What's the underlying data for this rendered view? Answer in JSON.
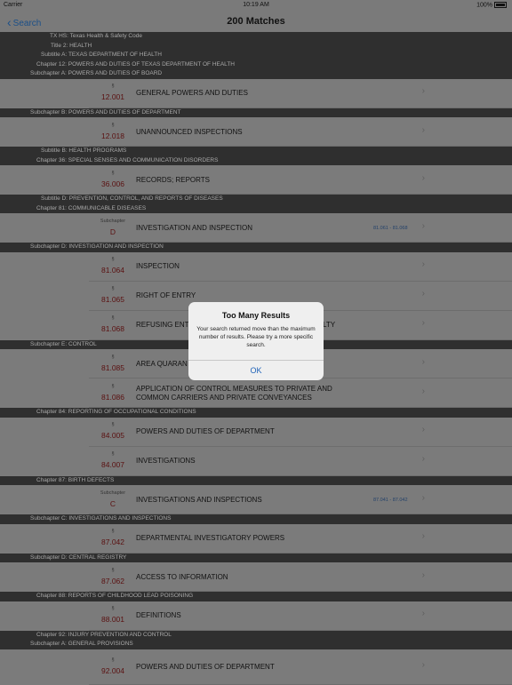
{
  "status_bar": {
    "carrier": "Carrier",
    "time": "10:19 AM",
    "battery": "100%"
  },
  "nav": {
    "back_label": "Search",
    "title": "200 Matches"
  },
  "list": [
    {
      "kind": "header",
      "indent": 56,
      "text": "TX HS: Texas Health & Safety Code"
    },
    {
      "kind": "header",
      "indent": 57,
      "text": "Title 2: HEALTH"
    },
    {
      "kind": "header",
      "indent": 46,
      "text": "Subtitle A: TEXAS DEPARTMENT OF HEALTH"
    },
    {
      "kind": "header",
      "indent": 41,
      "text": "Chapter 12: POWERS AND DUTIES OF TEXAS DEPARTMENT OF HEALTH"
    },
    {
      "kind": "header",
      "indent": 34,
      "text": "Subchapter A: POWERS AND DUTIES OF BOARD"
    },
    {
      "kind": "row",
      "h": 33,
      "symbol": "§",
      "number": "12.001",
      "title": "GENERAL POWERS AND DUTIES"
    },
    {
      "kind": "header",
      "indent": 34,
      "text": "Subchapter B: POWERS AND DUTIES OF DEPARTMENT"
    },
    {
      "kind": "row",
      "h": 33,
      "symbol": "§",
      "number": "12.018",
      "title": "UNANNOUNCED INSPECTIONS"
    },
    {
      "kind": "header",
      "indent": 46,
      "text": "Subtitle B: HEALTH PROGRAMS"
    },
    {
      "kind": "header",
      "indent": 41,
      "text": "Chapter 36: SPECIAL SENSES AND COMMUNICATION DISORDERS"
    },
    {
      "kind": "row",
      "h": 33,
      "symbol": "§",
      "number": "36.006",
      "title": "RECORDS;  REPORTS"
    },
    {
      "kind": "header",
      "indent": 46,
      "text": "Subtitle D: PREVENTION, CONTROL, AND REPORTS OF DISEASES"
    },
    {
      "kind": "header",
      "indent": 41,
      "text": "Chapter 81: COMMUNICABLE DISEASES"
    },
    {
      "kind": "row",
      "h": 33,
      "symbol": "Subchapter",
      "number": "D",
      "title": "INVESTIGATION AND INSPECTION",
      "range": "81.061 - 81.068"
    },
    {
      "kind": "header",
      "indent": 34,
      "text": "Subchapter D: INVESTIGATION AND INSPECTION"
    },
    {
      "kind": "row",
      "h": 33,
      "symbol": "§",
      "number": "81.064",
      "title": "INSPECTION"
    },
    {
      "kind": "row",
      "h": 33,
      "symbol": "§",
      "number": "81.065",
      "title": "RIGHT OF ENTRY"
    },
    {
      "kind": "row",
      "h": 33,
      "symbol": "§",
      "number": "81.068",
      "title": "REFUSING ENT",
      "title_end": "LTY"
    },
    {
      "kind": "header",
      "indent": 34,
      "text": "Subchapter E: CONTROL"
    },
    {
      "kind": "row",
      "h": 33,
      "symbol": "§",
      "number": "81.085",
      "title": "AREA QUARAN"
    },
    {
      "kind": "row",
      "h": 33,
      "symbol": "§",
      "number": "81.086",
      "title": "APPLICATION OF CONTROL MEASURES TO PRIVATE AND",
      "title2": "COMMON CARRIERS AND PRIVATE CONVEYANCES"
    },
    {
      "kind": "header",
      "indent": 41,
      "text": "Chapter 84: REPORTING OF OCCUPATIONAL CONDITIONS"
    },
    {
      "kind": "row",
      "h": 33,
      "symbol": "§",
      "number": "84.005",
      "title": "POWERS AND DUTIES OF DEPARTMENT"
    },
    {
      "kind": "row",
      "h": 33,
      "symbol": "§",
      "number": "84.007",
      "title": "INVESTIGATIONS"
    },
    {
      "kind": "header",
      "indent": 41,
      "text": "Chapter 87: BIRTH DEFECTS"
    },
    {
      "kind": "row",
      "h": 33,
      "symbol": "Subchapter",
      "number": "C",
      "title": "INVESTIGATIONS AND INSPECTIONS",
      "range": "87.041 - 87.042"
    },
    {
      "kind": "header",
      "indent": 34,
      "text": "Subchapter C: INVESTIGATIONS AND INSPECTIONS"
    },
    {
      "kind": "row",
      "h": 33,
      "symbol": "§",
      "number": "87.042",
      "title": "DEPARTMENTAL INVESTIGATORY POWERS"
    },
    {
      "kind": "header",
      "indent": 34,
      "text": "Subchapter D: CENTRAL REGISTRY"
    },
    {
      "kind": "row",
      "h": 33,
      "symbol": "§",
      "number": "87.062",
      "title": "ACCESS TO INFORMATION"
    },
    {
      "kind": "header",
      "indent": 41,
      "text": "Chapter 88: REPORTS OF CHILDHOOD LEAD POISONING"
    },
    {
      "kind": "row",
      "h": 33,
      "symbol": "§",
      "number": "88.001",
      "title": "DEFINITIONS"
    },
    {
      "kind": "header",
      "indent": 41,
      "text": "Chapter 92: INJURY PREVENTION AND CONTROL"
    },
    {
      "kind": "header",
      "indent": 34,
      "text": "Subchapter A: GENERAL PROVISIONS"
    },
    {
      "kind": "row",
      "h": 40,
      "symbol": "§",
      "number": "92.004",
      "title": "POWERS AND DUTIES OF DEPARTMENT"
    }
  ],
  "alert": {
    "title": "Too Many Results",
    "message": "Your search returned move than the maximum number of results. Please try a more specific search.",
    "ok_label": "OK"
  }
}
